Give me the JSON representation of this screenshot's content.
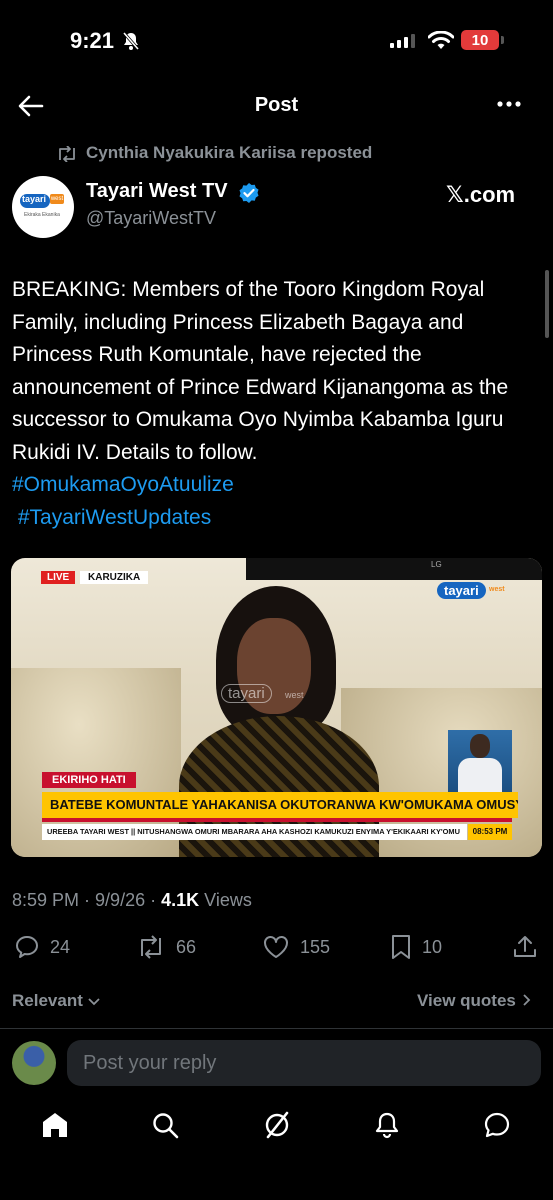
{
  "status_bar": {
    "time": "9:21",
    "battery": "10"
  },
  "nav": {
    "title": "Post"
  },
  "repost": {
    "text": "Cynthia Nyakukira Kariisa reposted"
  },
  "author": {
    "name": "Tayari West TV",
    "handle": "@TayariWestTV",
    "source": "𝕏.com",
    "avatar_logo": "tayari",
    "avatar_logo_west": "west",
    "avatar_logo_sub": "Ekiraka Ekanika"
  },
  "post": {
    "text": "BREAKING: Members of the Tooro Kingdom Royal Family, including Princess Elizabeth Bagaya and Princess Ruth Komuntale, have rejected the announcement of Prince Edward Kijanangoma as the successor to Omukama Oyo Nyimba Kabamba Iguru Rukidi IV.  Details to follow.",
    "hashtags": [
      "#OmukamaOyoAtuulize",
      " #TayariWestUpdates"
    ]
  },
  "media": {
    "live": "LIVE",
    "location": "KARUZIKA",
    "channel_logo": "tayari",
    "channel_west": "west",
    "watermark": "tayari",
    "watermark_west": "west",
    "tv_brand": "LG",
    "segment": "EKIRIHO HATI",
    "headline": "BATEBE KOMUNTALE YAHAKANISA OKUTORANWA KW'OMUKAMA OMUSYA",
    "ticker": "UREEBA TAYARI WEST || NITUSHANGWA OMURI MBARARA AHA KASHOZI KAMUKUZI ENYIMA Y'EKIKAARI KY'OMU",
    "ticker_time": "08:53 PM"
  },
  "meta": {
    "time": "8:59 PM",
    "date": "9/9/26",
    "views_count": "4.1K",
    "views_label": "Views"
  },
  "actions": {
    "replies": "24",
    "reposts": "66",
    "likes": "155",
    "bookmarks": "10"
  },
  "sort": {
    "label": "Relevant",
    "view_quotes": "View quotes"
  },
  "reply": {
    "placeholder": "Post your reply"
  },
  "colors": {
    "accent": "#1d9bf0",
    "muted": "#8b9197",
    "background": "#000000",
    "battery": "#e23a3a"
  },
  "icons": [
    "bell-slash-icon",
    "signal-icon",
    "wifi-icon",
    "back-arrow-icon",
    "more-icon",
    "repost-icon",
    "verified-icon",
    "reply-icon",
    "like-icon",
    "bookmark-icon",
    "share-icon",
    "chevron-down-icon",
    "chevron-right-icon",
    "home-icon",
    "search-icon",
    "grok-icon",
    "notifications-icon",
    "messages-icon"
  ]
}
